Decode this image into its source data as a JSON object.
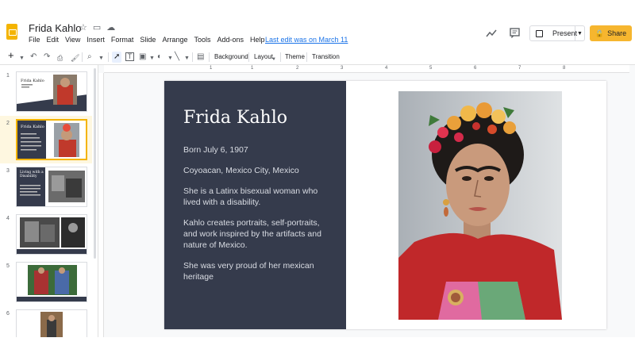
{
  "app": {
    "doc_title": "Frida Kahlo",
    "last_edit": "Last edit was on March 11",
    "menu": [
      "File",
      "Edit",
      "View",
      "Insert",
      "Format",
      "Slide",
      "Arrange",
      "Tools",
      "Add-ons",
      "Help"
    ],
    "present_label": "Present",
    "share_label": "Share"
  },
  "toolbar": {
    "background_label": "Background",
    "layout_label": "Layout",
    "theme_label": "Theme",
    "transition_label": "Transition"
  },
  "ruler": [
    "1",
    "1",
    "2",
    "3",
    "4",
    "5",
    "6",
    "7",
    "8",
    "9"
  ],
  "slides": [
    {
      "num": "1",
      "title": "Frida Kahlo"
    },
    {
      "num": "2",
      "title": "Frida Kahlo"
    },
    {
      "num": "3",
      "title": "Living with a Disability"
    },
    {
      "num": "4"
    },
    {
      "num": "5"
    },
    {
      "num": "6"
    }
  ],
  "current_slide": {
    "title": "Frida Kahlo",
    "paragraphs": [
      "Born July 6, 1907",
      "Coyoacan, Mexico City, Mexico",
      "She is a Latinx bisexual woman who lived with a disability.",
      "Kahlo creates portraits, self-portraits, and work inspired by the artifacts and nature of Mexico.",
      "She was very proud of her mexican heritage"
    ]
  },
  "colors": {
    "accent": "#f4b400",
    "share_bg": "#f6b62f",
    "slide_dark": "#353b4c",
    "link": "#1a73e8"
  }
}
